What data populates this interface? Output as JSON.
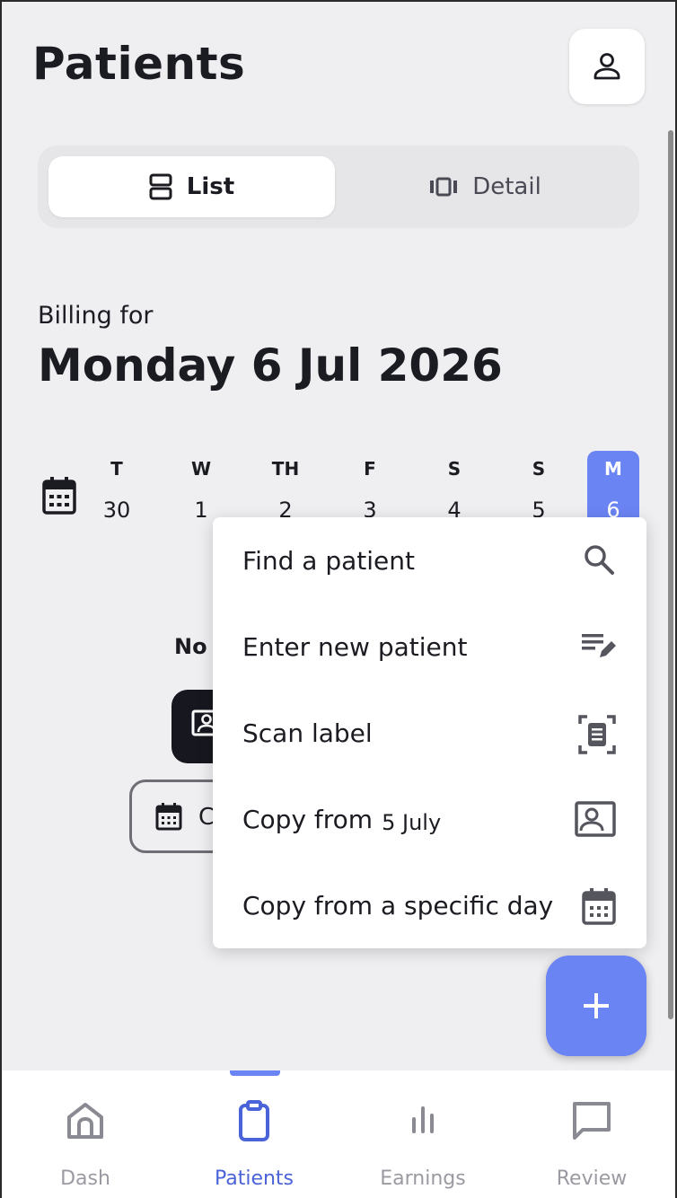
{
  "header": {
    "title": "Patients",
    "profile_icon": "person-icon"
  },
  "view_toggle": {
    "list_label": "List",
    "detail_label": "Detail",
    "selected": "List"
  },
  "billing": {
    "label": "Billing for",
    "date": "Monday 6 Jul 2026"
  },
  "calendar_strip": {
    "days": [
      {
        "name": "T",
        "date": "30"
      },
      {
        "name": "W",
        "date": "1"
      },
      {
        "name": "TH",
        "date": "2"
      },
      {
        "name": "F",
        "date": "3"
      },
      {
        "name": "S",
        "date": "4"
      },
      {
        "name": "S",
        "date": "5"
      },
      {
        "name": "M",
        "date": "6"
      }
    ],
    "active_index": 6
  },
  "empty_state": {
    "partial_text": "No",
    "outline_button_partial": "C"
  },
  "add_menu": {
    "items": [
      {
        "label": "Find a patient",
        "icon": "search-icon"
      },
      {
        "label": "Enter new patient",
        "icon": "edit-note-icon"
      },
      {
        "label": "Scan label",
        "icon": "scan-document-icon"
      },
      {
        "label": "Copy from",
        "sub": "5 July",
        "icon": "id-card-icon"
      },
      {
        "label": "Copy from a specific day",
        "icon": "calendar-icon"
      }
    ]
  },
  "fab": {
    "icon": "plus-icon"
  },
  "bottom_nav": {
    "items": [
      {
        "label": "Dash",
        "icon": "home-icon"
      },
      {
        "label": "Patients",
        "icon": "clipboard-icon"
      },
      {
        "label": "Earnings",
        "icon": "bar-chart-icon"
      },
      {
        "label": "Review",
        "icon": "chat-icon"
      }
    ],
    "active": "Patients"
  },
  "colors": {
    "accent": "#6b84f4",
    "active_nav_text": "#4a63d8",
    "background": "#efeff1",
    "dark": "#17171f"
  }
}
